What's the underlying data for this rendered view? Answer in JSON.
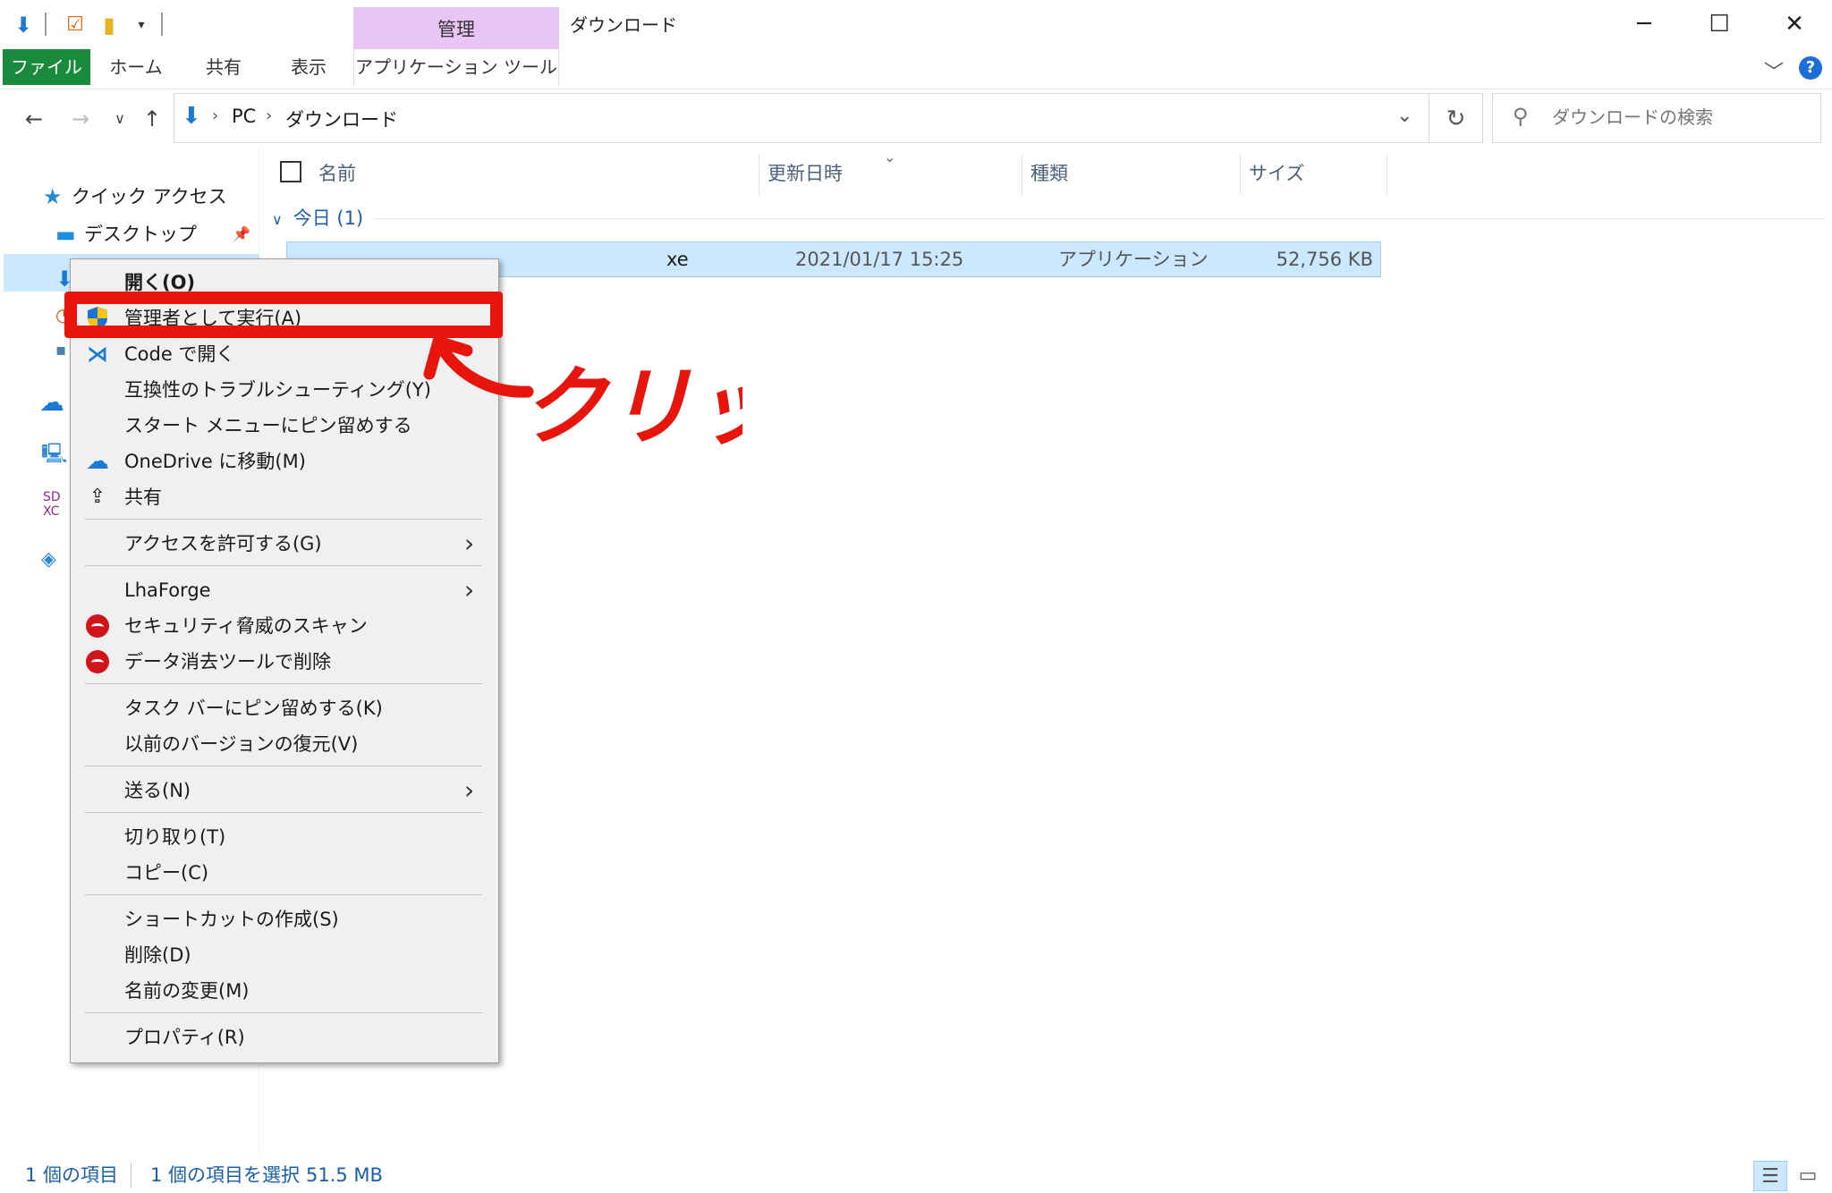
{
  "titlebar": {
    "manage_tab": "管理",
    "window_title": "ダウンロード",
    "minimize": "─",
    "maximize": "☐",
    "close": "✕"
  },
  "ribbon": {
    "tabs": [
      "ファイル",
      "ホーム",
      "共有",
      "表示",
      "アプリケーション ツール"
    ]
  },
  "address": {
    "crumbs": [
      "PC",
      "ダウンロード"
    ],
    "search_placeholder": "ダウンロードの検索"
  },
  "sidebar": {
    "items": [
      {
        "label": "クイック アクセス",
        "icon": "star-icon"
      },
      {
        "label": "デスクトップ",
        "icon": "desktop-icon"
      }
    ]
  },
  "filelist": {
    "columns": [
      "名前",
      "更新日時",
      "種類",
      "サイズ"
    ],
    "group": "今日 (1)",
    "rows": [
      {
        "name": "xe",
        "date": "2021/01/17 15:25",
        "type": "アプリケーション",
        "size": "52,756 KB"
      }
    ]
  },
  "status": {
    "count": "1 個の項目",
    "selected": "1 個の項目を選択",
    "size": "51.5 MB"
  },
  "context_menu": {
    "items": [
      {
        "label": "開く(O)",
        "bold": true
      },
      {
        "label": "管理者として実行(A)",
        "icon": "uac-shield-icon"
      },
      {
        "label": "Code で開く",
        "icon": "vscode-icon"
      },
      {
        "label": "互換性のトラブルシューティング(Y)"
      },
      {
        "label": "スタート メニューにピン留めする"
      },
      {
        "label": "OneDrive に移動(M)",
        "icon": "onedrive-icon"
      },
      {
        "label": "共有",
        "icon": "share-icon"
      },
      {
        "label": "アクセスを許可する(G)",
        "submenu": true
      },
      {
        "label": "LhaForge",
        "submenu": true
      },
      {
        "label": "セキュリティ脅威のスキャン",
        "icon": "trendmicro-icon"
      },
      {
        "label": "データ消去ツールで削除",
        "icon": "trendmicro-icon"
      },
      {
        "label": "タスク バーにピン留めする(K)"
      },
      {
        "label": "以前のバージョンの復元(V)"
      },
      {
        "label": "送る(N)",
        "submenu": true
      },
      {
        "label": "切り取り(T)"
      },
      {
        "label": "コピー(C)"
      },
      {
        "label": "ショートカットの作成(S)"
      },
      {
        "label": "削除(D)"
      },
      {
        "label": "名前の変更(M)"
      },
      {
        "label": "プロパティ(R)"
      }
    ]
  },
  "annotation": {
    "text": "クリック",
    "color": "#e8150c"
  }
}
